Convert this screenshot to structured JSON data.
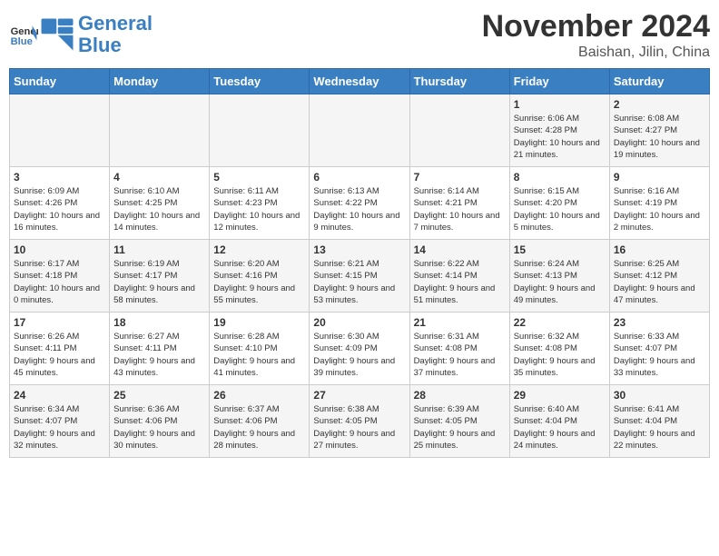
{
  "logo": {
    "text_general": "General",
    "text_blue": "Blue"
  },
  "title": "November 2024",
  "location": "Baishan, Jilin, China",
  "weekdays": [
    "Sunday",
    "Monday",
    "Tuesday",
    "Wednesday",
    "Thursday",
    "Friday",
    "Saturday"
  ],
  "weeks": [
    [
      {
        "day": "",
        "info": ""
      },
      {
        "day": "",
        "info": ""
      },
      {
        "day": "",
        "info": ""
      },
      {
        "day": "",
        "info": ""
      },
      {
        "day": "",
        "info": ""
      },
      {
        "day": "1",
        "info": "Sunrise: 6:06 AM\nSunset: 4:28 PM\nDaylight: 10 hours and 21 minutes."
      },
      {
        "day": "2",
        "info": "Sunrise: 6:08 AM\nSunset: 4:27 PM\nDaylight: 10 hours and 19 minutes."
      }
    ],
    [
      {
        "day": "3",
        "info": "Sunrise: 6:09 AM\nSunset: 4:26 PM\nDaylight: 10 hours and 16 minutes."
      },
      {
        "day": "4",
        "info": "Sunrise: 6:10 AM\nSunset: 4:25 PM\nDaylight: 10 hours and 14 minutes."
      },
      {
        "day": "5",
        "info": "Sunrise: 6:11 AM\nSunset: 4:23 PM\nDaylight: 10 hours and 12 minutes."
      },
      {
        "day": "6",
        "info": "Sunrise: 6:13 AM\nSunset: 4:22 PM\nDaylight: 10 hours and 9 minutes."
      },
      {
        "day": "7",
        "info": "Sunrise: 6:14 AM\nSunset: 4:21 PM\nDaylight: 10 hours and 7 minutes."
      },
      {
        "day": "8",
        "info": "Sunrise: 6:15 AM\nSunset: 4:20 PM\nDaylight: 10 hours and 5 minutes."
      },
      {
        "day": "9",
        "info": "Sunrise: 6:16 AM\nSunset: 4:19 PM\nDaylight: 10 hours and 2 minutes."
      }
    ],
    [
      {
        "day": "10",
        "info": "Sunrise: 6:17 AM\nSunset: 4:18 PM\nDaylight: 10 hours and 0 minutes."
      },
      {
        "day": "11",
        "info": "Sunrise: 6:19 AM\nSunset: 4:17 PM\nDaylight: 9 hours and 58 minutes."
      },
      {
        "day": "12",
        "info": "Sunrise: 6:20 AM\nSunset: 4:16 PM\nDaylight: 9 hours and 55 minutes."
      },
      {
        "day": "13",
        "info": "Sunrise: 6:21 AM\nSunset: 4:15 PM\nDaylight: 9 hours and 53 minutes."
      },
      {
        "day": "14",
        "info": "Sunrise: 6:22 AM\nSunset: 4:14 PM\nDaylight: 9 hours and 51 minutes."
      },
      {
        "day": "15",
        "info": "Sunrise: 6:24 AM\nSunset: 4:13 PM\nDaylight: 9 hours and 49 minutes."
      },
      {
        "day": "16",
        "info": "Sunrise: 6:25 AM\nSunset: 4:12 PM\nDaylight: 9 hours and 47 minutes."
      }
    ],
    [
      {
        "day": "17",
        "info": "Sunrise: 6:26 AM\nSunset: 4:11 PM\nDaylight: 9 hours and 45 minutes."
      },
      {
        "day": "18",
        "info": "Sunrise: 6:27 AM\nSunset: 4:11 PM\nDaylight: 9 hours and 43 minutes."
      },
      {
        "day": "19",
        "info": "Sunrise: 6:28 AM\nSunset: 4:10 PM\nDaylight: 9 hours and 41 minutes."
      },
      {
        "day": "20",
        "info": "Sunrise: 6:30 AM\nSunset: 4:09 PM\nDaylight: 9 hours and 39 minutes."
      },
      {
        "day": "21",
        "info": "Sunrise: 6:31 AM\nSunset: 4:08 PM\nDaylight: 9 hours and 37 minutes."
      },
      {
        "day": "22",
        "info": "Sunrise: 6:32 AM\nSunset: 4:08 PM\nDaylight: 9 hours and 35 minutes."
      },
      {
        "day": "23",
        "info": "Sunrise: 6:33 AM\nSunset: 4:07 PM\nDaylight: 9 hours and 33 minutes."
      }
    ],
    [
      {
        "day": "24",
        "info": "Sunrise: 6:34 AM\nSunset: 4:07 PM\nDaylight: 9 hours and 32 minutes."
      },
      {
        "day": "25",
        "info": "Sunrise: 6:36 AM\nSunset: 4:06 PM\nDaylight: 9 hours and 30 minutes."
      },
      {
        "day": "26",
        "info": "Sunrise: 6:37 AM\nSunset: 4:06 PM\nDaylight: 9 hours and 28 minutes."
      },
      {
        "day": "27",
        "info": "Sunrise: 6:38 AM\nSunset: 4:05 PM\nDaylight: 9 hours and 27 minutes."
      },
      {
        "day": "28",
        "info": "Sunrise: 6:39 AM\nSunset: 4:05 PM\nDaylight: 9 hours and 25 minutes."
      },
      {
        "day": "29",
        "info": "Sunrise: 6:40 AM\nSunset: 4:04 PM\nDaylight: 9 hours and 24 minutes."
      },
      {
        "day": "30",
        "info": "Sunrise: 6:41 AM\nSunset: 4:04 PM\nDaylight: 9 hours and 22 minutes."
      }
    ]
  ]
}
